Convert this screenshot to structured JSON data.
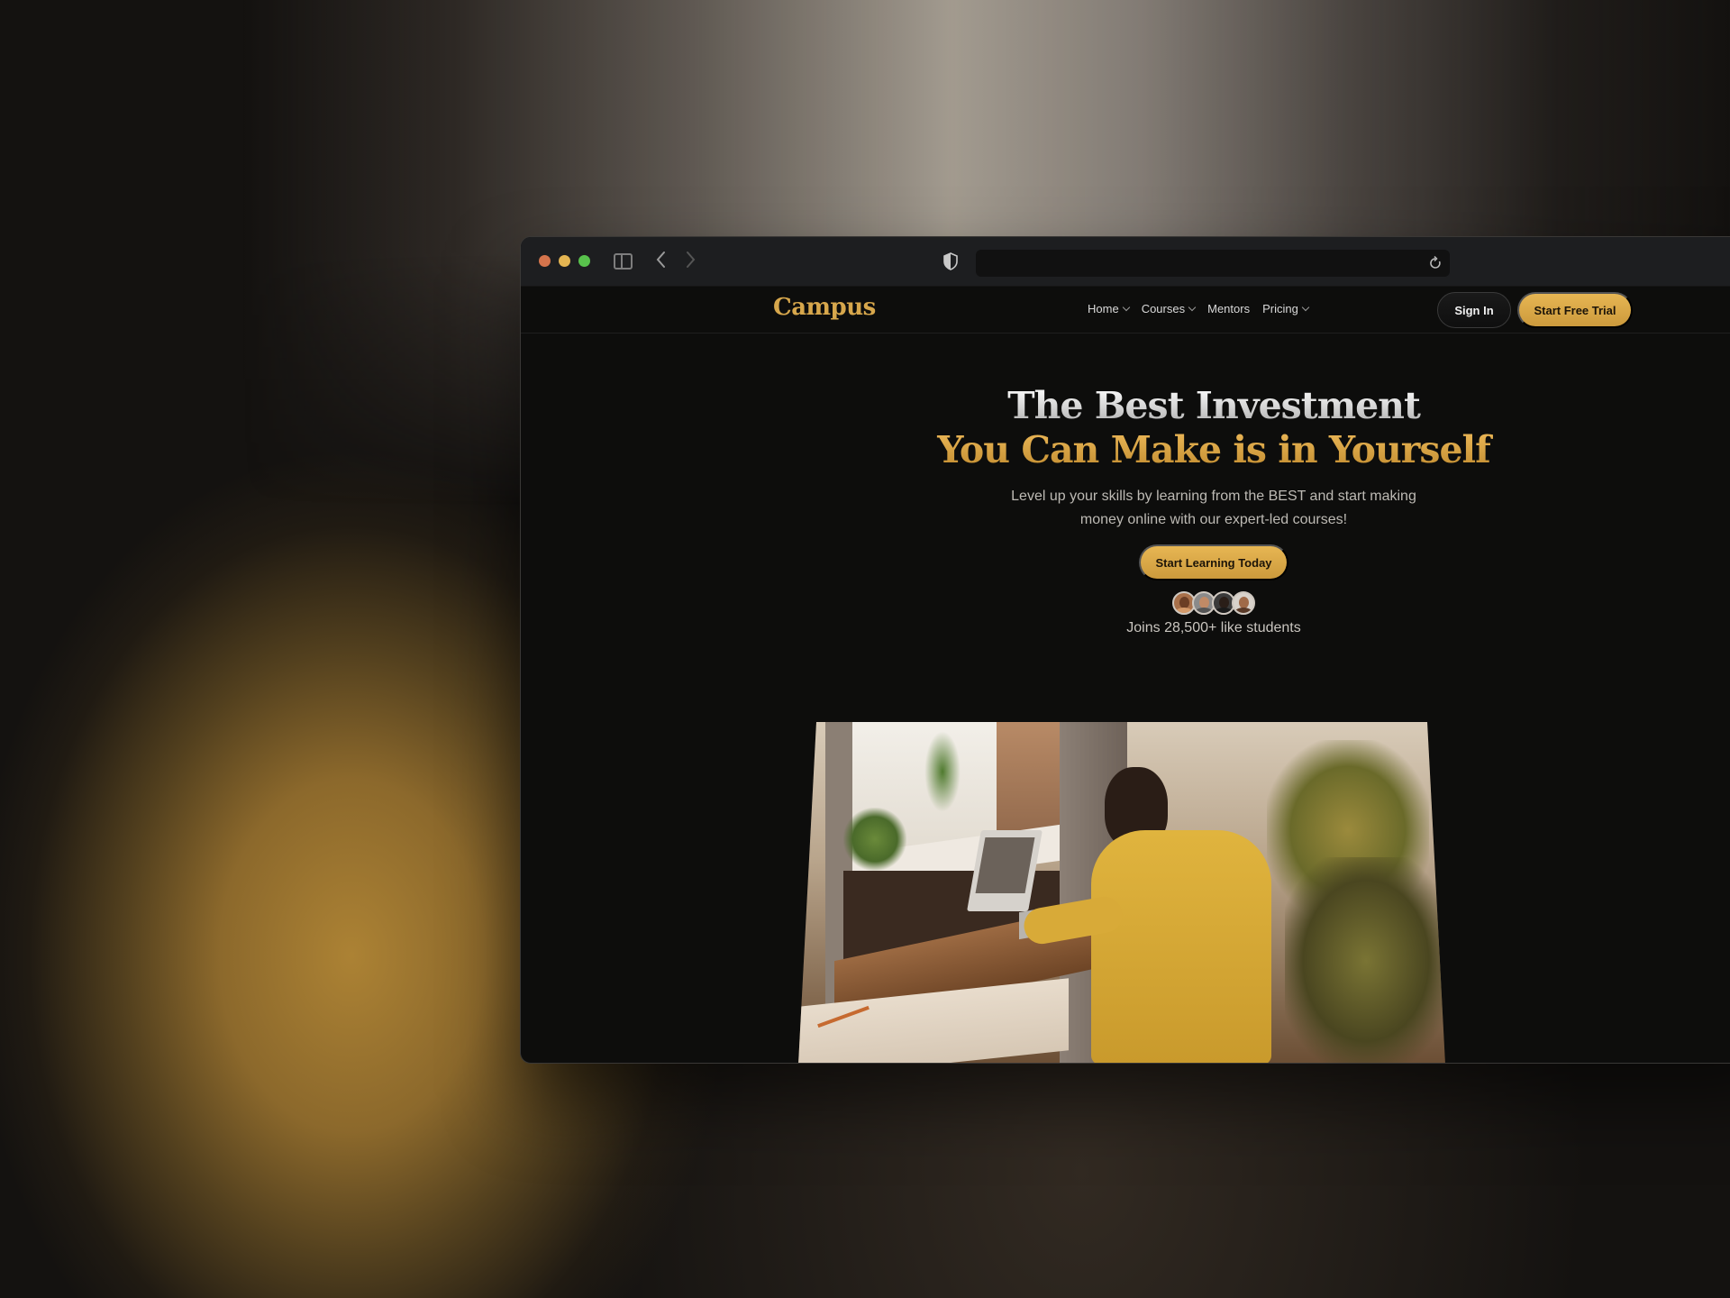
{
  "browser": {
    "address_value": "",
    "icons": {
      "sidebar": "sidebar-toggle-icon",
      "back": "chevron-left-icon",
      "forward": "chevron-right-icon",
      "privacy": "shield-icon",
      "reload": "reload-icon"
    }
  },
  "site": {
    "logo": "Campus",
    "nav": [
      {
        "label": "Home",
        "has_dropdown": true
      },
      {
        "label": "Courses",
        "has_dropdown": true
      },
      {
        "label": "Mentors",
        "has_dropdown": false
      },
      {
        "label": "Pricing",
        "has_dropdown": true
      }
    ],
    "sign_in_label": "Sign In",
    "trial_label": "Start Free Trial"
  },
  "hero": {
    "title_line1": "The Best Investment",
    "title_line2": "You Can Make is in Yourself",
    "subtitle": "Level up your skills by learning from the BEST and start making money online with our expert-led courses!",
    "cta_label": "Start Learning Today",
    "social_proof": "Joins 28,500+ like students",
    "avatar_count": 4
  },
  "image": {
    "alt": "Man in yellow sweater on a video call at a laptop on a wooden desk with plants"
  },
  "colors": {
    "accent": "#d7a74c",
    "button_gold": "#e0ad4b",
    "page_bg": "#0d0d0c",
    "chrome_bg": "#1d1e20"
  }
}
